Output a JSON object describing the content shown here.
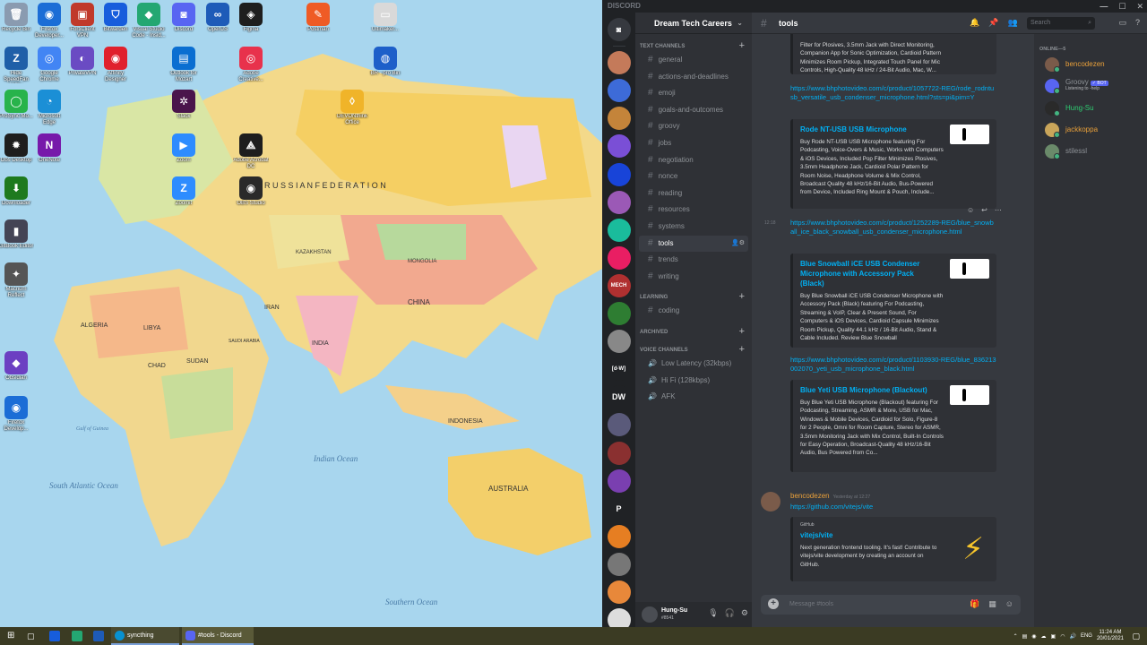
{
  "desktop": {
    "map_labels": [
      "R U S S I A N   F E D E R A T I O N",
      "CHINA",
      "MONGOLIA",
      "KAZAKHSTAN",
      "IRAN",
      "INDIA",
      "ALGERIA",
      "LIBYA",
      "SUDAN",
      "CHAD",
      "INDONESIA",
      "AUSTRALIA",
      "Indian Ocean",
      "South Atlantic Ocean",
      "Southern Ocean",
      "Gulf of Guinea",
      "SAUDI ARABIA"
    ],
    "icons": [
      {
        "label": "Recycle Bin",
        "color": "#8a9bb0",
        "glyph": "🗑"
      },
      {
        "label": "Firefox Developer...",
        "color": "#1b6dd6",
        "glyph": "◉"
      },
      {
        "label": "FortiClient VPN",
        "color": "#c0392b",
        "glyph": "▣"
      },
      {
        "label": "Bitwarden",
        "color": "#175ddc",
        "glyph": "⛉"
      },
      {
        "label": "Visual Studio Code - Insid...",
        "color": "#24a772",
        "glyph": "◆"
      },
      {
        "label": "Discord",
        "color": "#5865f2",
        "glyph": "◙"
      },
      {
        "label": "OpenJS",
        "color": "#1e5bb8",
        "glyph": "∞"
      },
      {
        "label": "Figma",
        "color": "#1e1e1e",
        "glyph": "◈"
      },
      {
        "label": "Postman",
        "color": "#ef5b25",
        "glyph": "✎"
      },
      {
        "label": "Ultimaker...",
        "color": "#d9d9d9",
        "glyph": "▭"
      },
      {
        "label": "Hide SpeedFan Utility",
        "color": "#1f5fa8",
        "glyph": "Z"
      },
      {
        "label": "Google Chrome",
        "color": "#4285f4",
        "glyph": "◎"
      },
      {
        "label": "PrivateVPN",
        "color": "#6a4bc3",
        "glyph": "◐"
      },
      {
        "label": "Affinity Designer",
        "color": "#e0202c",
        "glyph": "◉"
      },
      {
        "label": "Outlook for Mozart",
        "color": "#0a6ed1",
        "glyph": "▤"
      },
      {
        "label": "Adobe Creative...",
        "color": "#e8324c",
        "glyph": "◎"
      },
      {
        "label": "BR - pro Bin",
        "color": "#1d5fc9",
        "glyph": "◍"
      },
      {
        "label": "ProSync Mo...",
        "color": "#28b34b",
        "glyph": "◯"
      },
      {
        "label": "Microsoft Edge",
        "color": "#1b8fd6",
        "glyph": "◔"
      },
      {
        "label": "Slack",
        "color": "#4a154b",
        "glyph": "✲"
      },
      {
        "label": "DEVONthink Office",
        "color": "#f0b429",
        "glyph": "◊"
      },
      {
        "label": "Obs Desktop",
        "color": "#1e1e1e",
        "glyph": "✹"
      },
      {
        "label": "OneNote",
        "color": "#7719aa",
        "glyph": "N"
      },
      {
        "label": "Zoom",
        "color": "#2d8cff",
        "glyph": "▶"
      },
      {
        "label": "Adobe Acrobat DC",
        "color": "#1e1e1e",
        "glyph": "⟁"
      },
      {
        "label": "Downloader",
        "color": "#1e7a1e",
        "glyph": "⬇"
      },
      {
        "label": "Zoomit",
        "color": "#2d8cff",
        "glyph": "Z"
      },
      {
        "label": "OBS Studio",
        "color": "#2a2a2a",
        "glyph": "◉"
      },
      {
        "label": "GitBook Editor",
        "color": "#445",
        "glyph": "▮"
      },
      {
        "label": "Macrium Reflect",
        "color": "#555",
        "glyph": "✦"
      },
      {
        "label": "Obsidian",
        "color": "#6c3fc2",
        "glyph": "◆"
      },
      {
        "label": "Firefox Develop...",
        "color": "#1b6dd6",
        "glyph": "◉"
      }
    ]
  },
  "discord": {
    "app_title": "DISCORD",
    "window_controls": [
      "—",
      "☐",
      "✕"
    ],
    "server_name": "Dream Tech Careers",
    "guilds": [
      {
        "label": "",
        "color": "#c47a5a"
      },
      {
        "label": "",
        "color": "#3d6bd8"
      },
      {
        "label": "",
        "color": "#c4843a"
      },
      {
        "label": "",
        "color": "#7a4fd6"
      },
      {
        "label": "",
        "color": "#1844d8"
      },
      {
        "label": "",
        "color": "#9b59b6"
      },
      {
        "label": "",
        "color": "#1abc9c"
      },
      {
        "label": "",
        "color": "#e91e63"
      },
      {
        "label": "MECH",
        "color": "#b03030"
      },
      {
        "label": "",
        "color": "#2e7d32"
      },
      {
        "label": "",
        "color": "#888"
      },
      {
        "label": "[d-W]",
        "color": "#202225"
      },
      {
        "label": "DW",
        "color": "#202225"
      },
      {
        "label": "",
        "color": "#5a5a7a"
      },
      {
        "label": "",
        "color": "#8a3030"
      },
      {
        "label": "",
        "color": "#7a3fb0"
      },
      {
        "label": "P",
        "color": "#202225"
      },
      {
        "label": "",
        "color": "#e67e22"
      },
      {
        "label": "",
        "color": "#777"
      },
      {
        "label": "",
        "color": "#e8883a"
      },
      {
        "label": "",
        "color": "#ddd"
      }
    ],
    "categories": {
      "text": "TEXT CHANNELS",
      "learning": "LEARNING",
      "archived": "ARCHIVED",
      "voice": "VOICE CHANNELS"
    },
    "text_channels": [
      "general",
      "actions-and-deadlines",
      "emoji",
      "goals-and-outcomes",
      "groovy",
      "jobs",
      "negotiation",
      "nonce",
      "reading",
      "resources",
      "systems",
      "tools",
      "trends",
      "writing"
    ],
    "active_channel": "tools",
    "learning_channels": [
      "coding"
    ],
    "voice_channels": [
      "Low Latency (32kbps)",
      "Hi Fi (128kbps)",
      "AFK"
    ],
    "user": {
      "name": "Hung-Su",
      "discriminator": "#8541"
    },
    "header": {
      "channel": "tools",
      "search_placeholder": "Search"
    },
    "messages": {
      "top_embed_desc": "Filter for Plosives, 3.5mm Jack with Direct Monitoring, Companion App for Sonic Optimization, Cardioid Pattern Minimizes Room Pickup, Integrated Touch Panel for Mic Controls, High-Quality 48 kHz / 24-Bit Audio, Mac, W...",
      "link1": "https://www.bhphotovideo.com/c/product/1057722-REG/rode_rodntusb_versatile_usb_condenser_microphone.html?sts=pi&pim=Y",
      "embed1_title": "Rode NT-USB USB Microphone",
      "embed1_desc": "Buy Rode NT-USB USB Microphone featuring For Podcasting, Voice-Overs & Music, Works with Computers & iOS Devices, Included Pop Filter Minimizes Plosives, 3.5mm Headphone Jack, Cardioid Polar Pattern for Room Noise, Headphone Volume & Mix Control, Broadcast Quality 48 kHz/16-Bit Audio, Bus-Powered from Device, Included Ring Mount & Pouch, Include...",
      "time2": "12:18",
      "link2": "https://www.bhphotovideo.com/c/product/1252289-REG/blue_snowball_ice_black_snowball_usb_condenser_microphone.html",
      "embed2_title": "Blue Snowball iCE USB Condenser Microphone with Accessory Pack (Black)",
      "embed2_desc": "Buy Blue Snowball iCE USB Condenser Microphone with Accessory Pack (Black) featuring For Podcasting, Streaming & VoIP, Clear & Present Sound, For Computers & iOS Devices, Cardioid Capsule Minimizes Room Pickup, Quality 44.1 kHz / 16-Bit Audio, Stand & Cable Included. Review Blue Snowball",
      "link3": "https://www.bhphotovideo.com/c/product/1103930-REG/blue_836213002070_yeti_usb_microphone_black.html",
      "embed3_title": "Blue Yeti USB Microphone (Blackout)",
      "embed3_desc": "Buy Blue Yeti USB Microphone (Blackout) featuring For Podcasting, Streaming, ASMR & More, USB for Mac, Windows & Mobile Devices, Cardioid for Solo, Figure-8 for 2 People, Omni for Room Capture, Stereo for ASMR, 3.5mm Monitoring Jack with Mix Control, Built-In Controls for Easy Operation, Broadcast-Quality 48 kHz/16-Bit Audio, Bus Powered from Co...",
      "author": "bencodezen",
      "author_time": "Yesterday at 12:27",
      "link4": "https://github.com/vitejs/vite",
      "embed4_provider": "GitHub",
      "embed4_title": "vitejs/vite",
      "embed4_desc": "Next generation frontend tooling. It's fast! Contribute to vitejs/vite development by creating an account on GitHub."
    },
    "composer_placeholder": "Message #tools",
    "members": {
      "heading": "ONLINE—5",
      "list": [
        {
          "name": "bencodezen",
          "activity": "",
          "color": "#e9a03a",
          "avatar": "#7a5b4a"
        },
        {
          "name": "Groovy",
          "activity": "Listening to -help",
          "color": "#8e9297",
          "avatar": "#5865f2",
          "bot": "✓ BOT"
        },
        {
          "name": "Hung-Su",
          "activity": "",
          "color": "#2ecc71",
          "avatar": "#2a2a2a"
        },
        {
          "name": "jackkoppa",
          "activity": "",
          "color": "#e9a03a",
          "avatar": "#c9a55a"
        },
        {
          "name": "stilessl",
          "activity": "",
          "color": "#8e9297",
          "avatar": "#6a8a6a"
        }
      ]
    }
  },
  "taskbar": {
    "apps": [
      {
        "label": "syncthing"
      },
      {
        "label": "#tools - Discord"
      }
    ],
    "lang": "ENG",
    "time": "11:24 AM",
    "date": "20/01/2021"
  }
}
